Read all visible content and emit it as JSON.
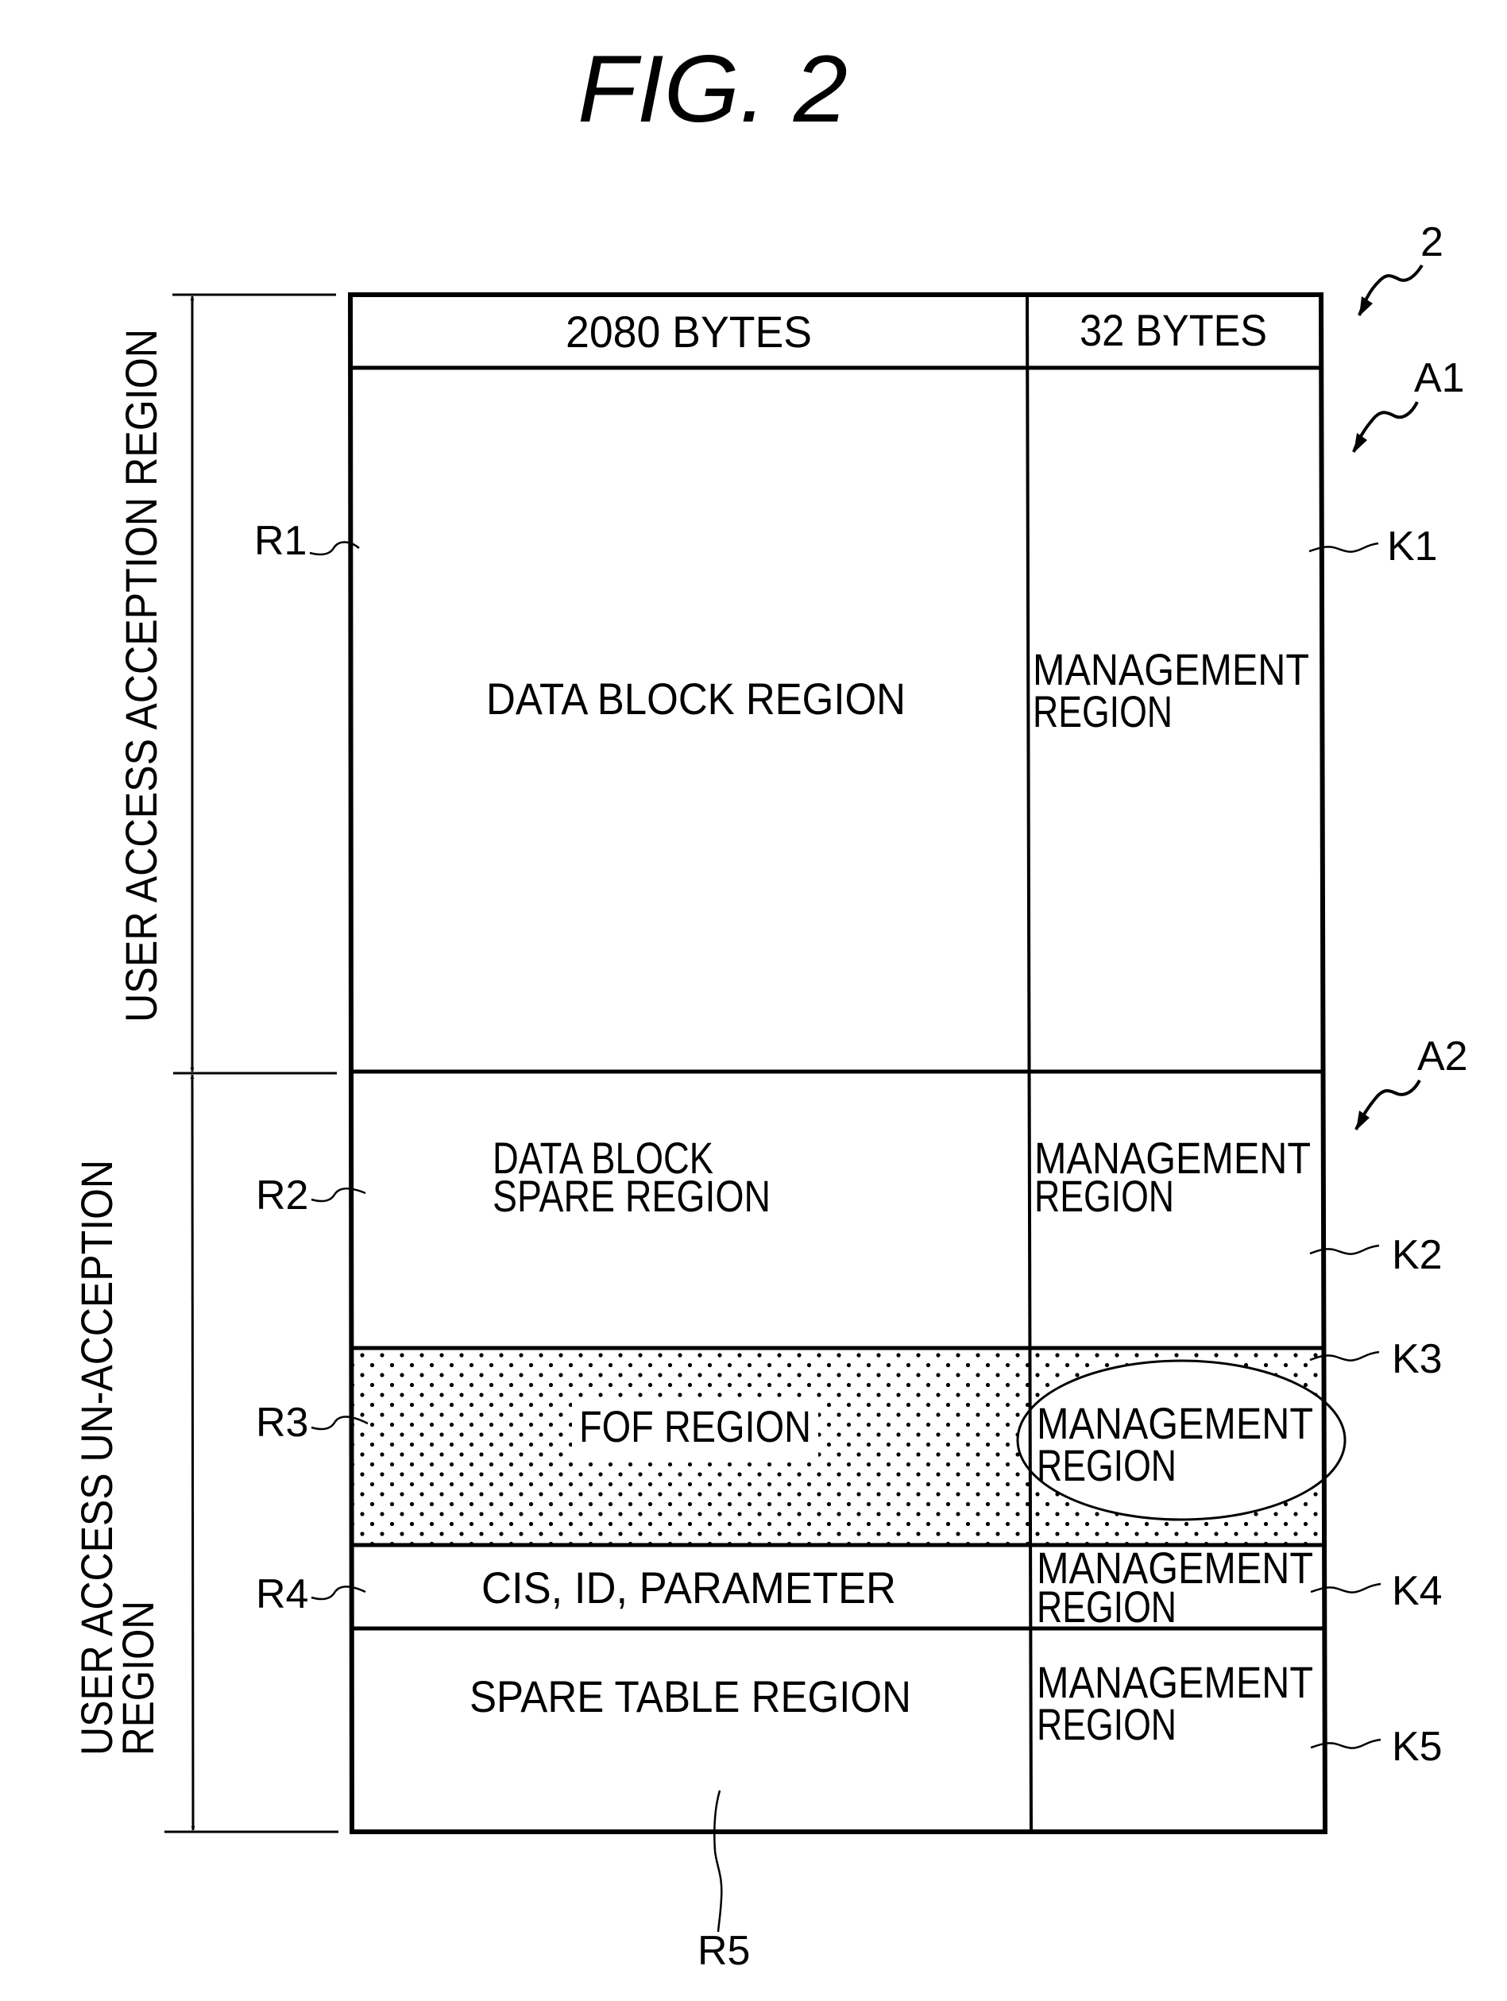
{
  "figure": {
    "title": "FIG. 2",
    "reference_numeral": "2"
  },
  "header": {
    "col1": "2080 BYTES",
    "col2": "32 BYTES"
  },
  "areas": [
    {
      "id": "A1",
      "label": "USER ACCESS ACCEPTION REGION"
    },
    {
      "id": "A2",
      "label_line1": "USER ACCESS UN-ACCEPTION",
      "label_line2": "REGION"
    }
  ],
  "rows": [
    {
      "ref": "R1",
      "main_lines": [
        "DATA BLOCK REGION"
      ],
      "mgmt_ref": "K1",
      "mgmt_lines": [
        "MANAGEMENT",
        "REGION"
      ],
      "shaded": false
    },
    {
      "ref": "R2",
      "main_lines": [
        "DATA BLOCK",
        "SPARE REGION"
      ],
      "mgmt_ref": "K2",
      "mgmt_lines": [
        "MANAGEMENT",
        "REGION"
      ],
      "shaded": false
    },
    {
      "ref": "R3",
      "main_lines": [
        "FOF REGION"
      ],
      "mgmt_ref": "K3",
      "mgmt_lines": [
        "MANAGEMENT",
        "REGION"
      ],
      "shaded": true,
      "mgmt_highlighted": true
    },
    {
      "ref": "R4",
      "main_lines": [
        "CIS, ID, PARAMETER"
      ],
      "mgmt_ref": "K4",
      "mgmt_lines": [
        "MANAGEMENT",
        "REGION"
      ],
      "shaded": false
    },
    {
      "ref": "R5",
      "main_lines": [
        "SPARE TABLE REGION"
      ],
      "mgmt_ref": "K5",
      "mgmt_lines": [
        "MANAGEMENT",
        "REGION"
      ],
      "shaded": false
    }
  ],
  "colors": {
    "ink": "#000000",
    "paper": "#ffffff"
  }
}
